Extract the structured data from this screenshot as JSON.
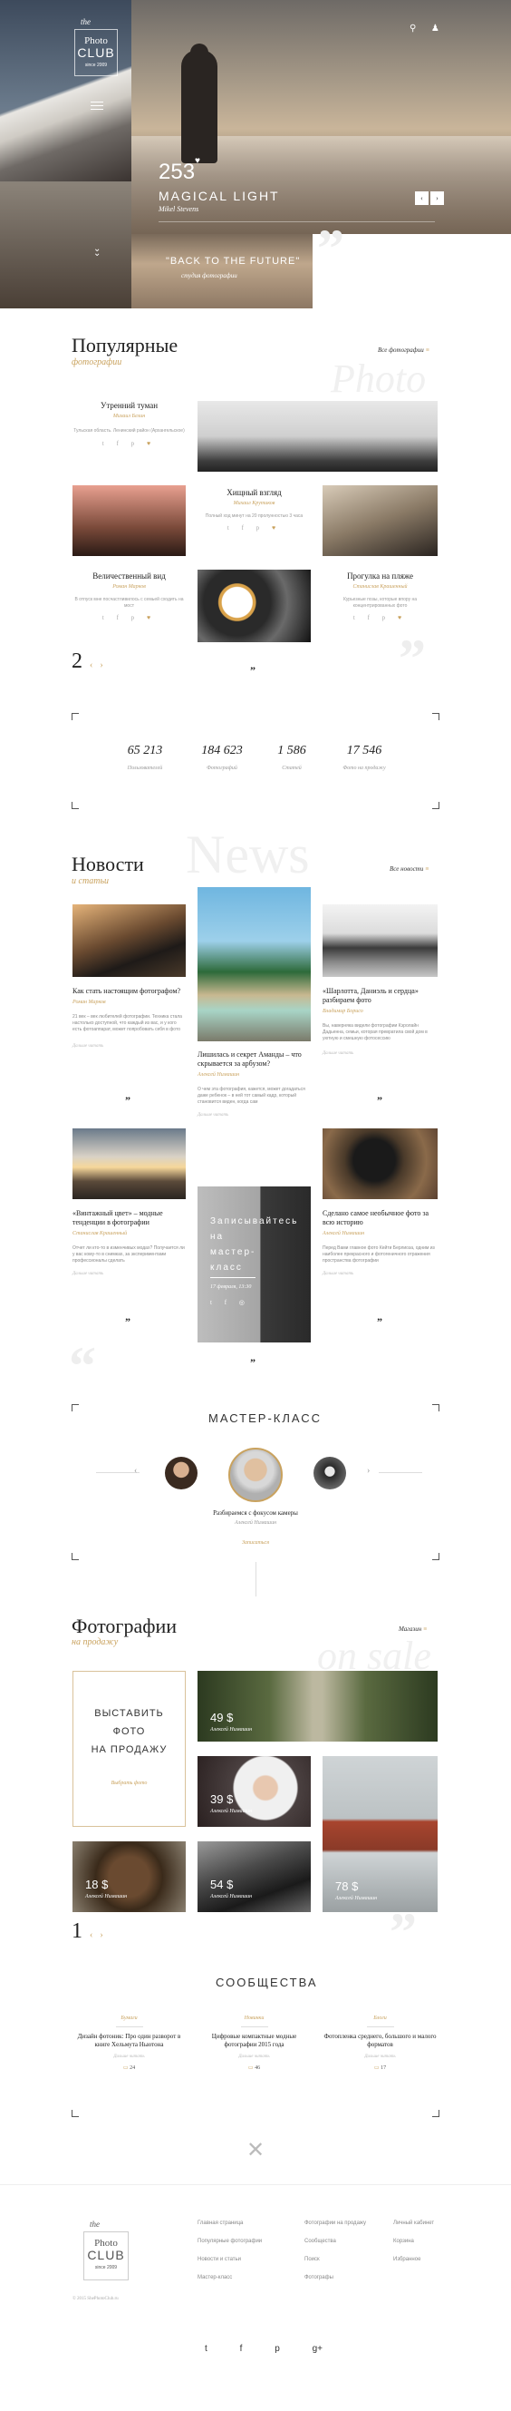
{
  "hero": {
    "logo": {
      "the": "the",
      "line1": "Photo",
      "line2": "CLUB",
      "since": "since 2009"
    },
    "count": "253",
    "title": "MAGICAL LIGHT",
    "author": "Mikel Stevens",
    "prev": "‹",
    "next": "›",
    "sub_title": "\"BACK TO THE FUTURE\"",
    "sub_author": "студия фотографии"
  },
  "popular": {
    "title": "Популярные",
    "subtitle": "фотографии",
    "all_link": "Все фотографии",
    "watermark": "Photo",
    "items": [
      {
        "title": "Утренний туман",
        "author": "Михаил Белин",
        "desc": "Тульская область. Ленинский район (Архангельское)"
      },
      {
        "title": "Хищный взгляд",
        "author": "Михаил Крутиков",
        "desc": "Полный ход минут на 20 пролунностью 3 часа"
      },
      {
        "title": "Величественный вид",
        "author": "Роман Марков",
        "desc": "В отпуск мне посчастливилось с семьей сходить на мост"
      },
      {
        "title": "Прогулка на пляже",
        "author": "Станислав Крашенный",
        "desc": "Курьезные позы, которые впору на концентрированных фото"
      }
    ],
    "page": "2",
    "prev": "‹",
    "next": "›"
  },
  "stats": [
    {
      "value": "65 213",
      "label": "Пользователей"
    },
    {
      "value": "184 623",
      "label": "Фотографий"
    },
    {
      "value": "1 586",
      "label": "Статей"
    },
    {
      "value": "17 546",
      "label": "Фото на продажу"
    }
  ],
  "news": {
    "title": "Новости",
    "subtitle": "и статьи",
    "all_link": "Все новости",
    "watermark": "News",
    "items": [
      {
        "title": "Как стать настоящим фотографом?",
        "author": "Роман Марков",
        "desc": "21 век – век любителей фотографии. Техника стала настолько доступной, что каждый из вас, и у кого есть фотоаппарат, может попробовать себя в фото",
        "more": "Дальше читать"
      },
      {
        "title": "Лишилась и секрет Аманды – что скрывается за арбузом?",
        "author": "Алексей Нимашин",
        "desc": "О чем эта фотография, кажется, может догадаться даже ребенок – в ней тот самый кадр, который становится виден, когда сам",
        "more": "Дальше читать"
      },
      {
        "title": "«Шарлотта, Даниэль и сердца» разбираем фото",
        "author": "Владимир Борисо",
        "desc": "Вы, наверняка видели фотографии Кэролайн Дадьенна, семьи, которая превратила свой дом в уютную и смешную фотосессию",
        "more": "Дальше читать"
      },
      {
        "title": "«Винтажный цвет» – модные тенденции в фотографии",
        "author": "Станислав Крашенный",
        "desc": "Отчет ли кто-то в изменчивых модах? Получается ли у вас кому-то в снимках, за экспериментами профессионалы сделать",
        "more": "Дальше читать"
      },
      {
        "title": "Записывайтесь на мастер-класс",
        "date": "17 февраля, 13:30",
        "author": "",
        "desc": "",
        "more": ""
      },
      {
        "title": "Сделано самое необычное фото за всю историю",
        "author": "Алексей Нимашин",
        "desc": "Перед Вами главное фото Кейти Берлиоза, одним из наиболее прекрасного и фотогеничного отражения пространства фотографии",
        "more": "Дальше читать"
      }
    ]
  },
  "masterclass": {
    "title": "МАСТЕР-КЛАСС",
    "caption": "Разбираемся с фокусом камеры",
    "author": "Алексей Нимашин",
    "link": "Записаться",
    "prev": "‹",
    "next": "›"
  },
  "sale": {
    "title": "Фотографии",
    "subtitle": "на продажу",
    "all_link": "Магазин",
    "watermark": "on sale",
    "promo_lines": [
      "ВЫСТАВИТЬ",
      "ФОТО",
      "НА ПРОДАЖУ"
    ],
    "promo_link": "Выбрать фото",
    "items": [
      {
        "price": "49 $",
        "author": "Алексей Нимашин"
      },
      {
        "price": "39 $",
        "author": "Алексей Нимашин"
      },
      {
        "price": "18 $",
        "author": "Алексей Нимашин"
      },
      {
        "price": "54 $",
        "author": "Алексей Нимашин"
      },
      {
        "price": "78 $",
        "author": "Алексей Нимашин"
      }
    ],
    "page": "1",
    "prev": "‹",
    "next": "›"
  },
  "community": {
    "title": "СООБЩЕСТВА",
    "items": [
      {
        "category": "Бумаги",
        "title": "Дизайн фотоник: Про один разворот в книге Хельмута Ньютона",
        "more": "Дальше читать",
        "count": "24"
      },
      {
        "category": "Новинки",
        "title": "Цифровые компактные модные фотографии 2015 года",
        "more": "Дальше читать",
        "count": "46"
      },
      {
        "category": "Блоги",
        "title": "Фотопленка среднего, большого и малого форматов",
        "more": "Дальше читать",
        "count": "17"
      }
    ]
  },
  "footer": {
    "logo": {
      "the": "the",
      "line1": "Photo",
      "line2": "CLUB",
      "since": "since 2009"
    },
    "copyright": "© 2015 ShePhotoClub.ru",
    "col1": [
      "Главная страница",
      "Популярные фотографии",
      "Новости и статьи",
      "Мастер-класс"
    ],
    "col2": [
      "Фотографии на продажу",
      "Сообщества",
      "Поиск",
      "Фотографы"
    ],
    "col3": [
      "Личный кабинет",
      "Корзина",
      "Избранное"
    ],
    "social": [
      "Twitter",
      "Facebook",
      "Pinterest",
      "Google+"
    ]
  }
}
